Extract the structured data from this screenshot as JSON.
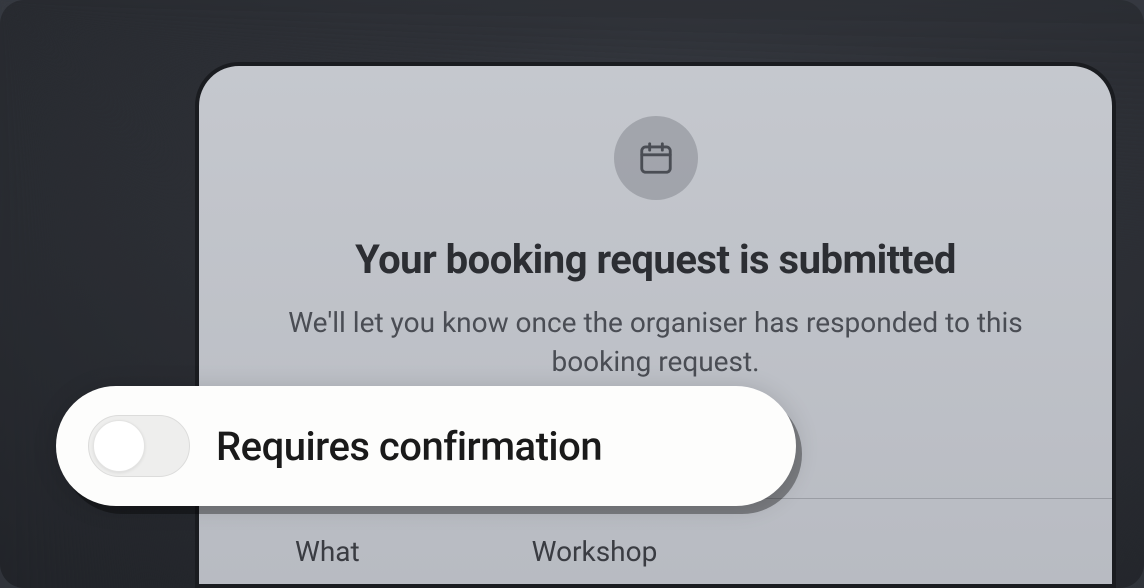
{
  "booking": {
    "title": "Your booking request is submitted",
    "subtitle": "We'll let you know once the organiser has responded to this booking request.",
    "icon": "calendar-icon",
    "details": {
      "label": "What",
      "value": "Workshop"
    }
  },
  "toggle": {
    "label": "Requires confirmation",
    "state": "off"
  }
}
